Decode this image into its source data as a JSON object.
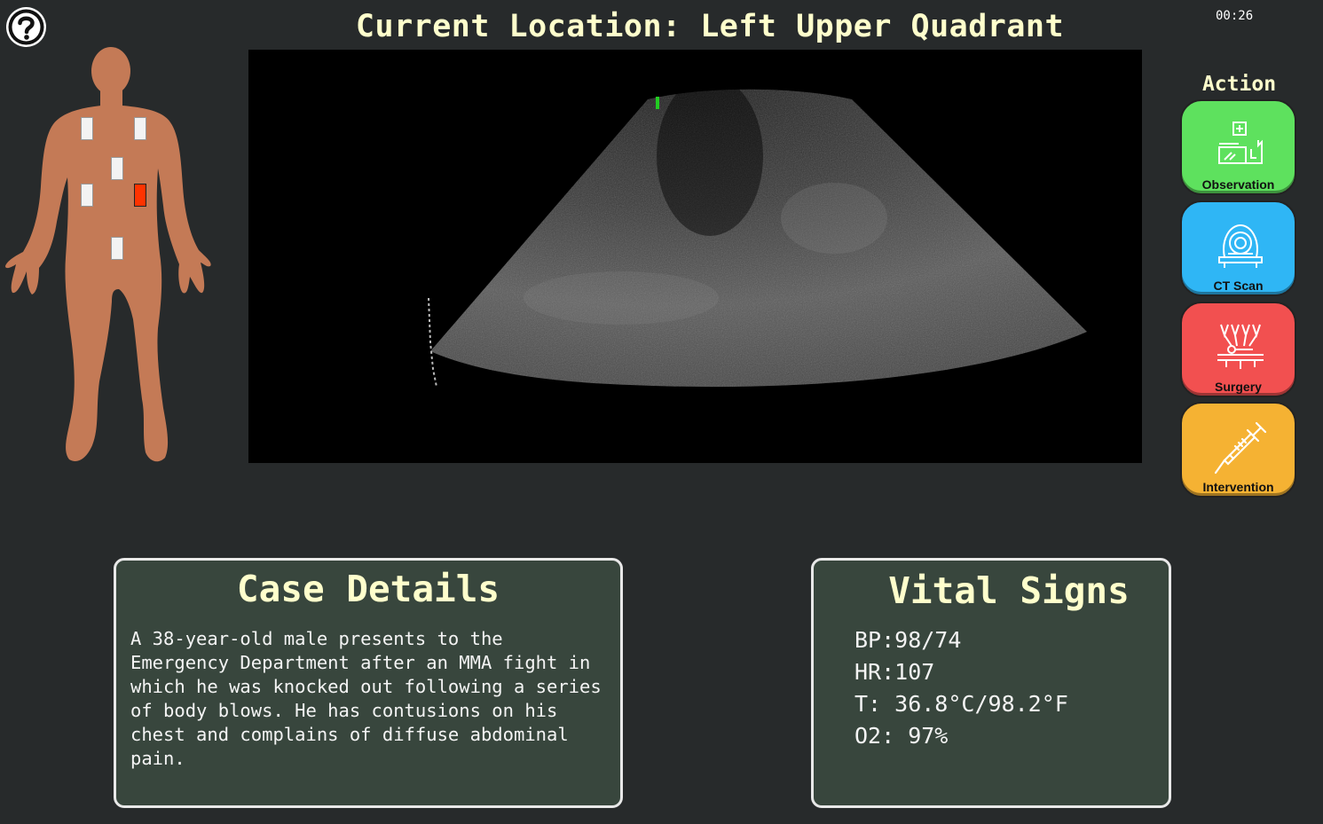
{
  "header": {
    "location_text": "Current Location: Left Upper Quadrant",
    "timer": "00:26"
  },
  "help": {
    "icon": "question-mark-icon"
  },
  "body_map": {
    "zones": [
      {
        "name": "right-chest",
        "active": false
      },
      {
        "name": "left-chest",
        "active": false
      },
      {
        "name": "subxiphoid",
        "active": false
      },
      {
        "name": "right-upper-quadrant",
        "active": false
      },
      {
        "name": "left-upper-quadrant",
        "active": true
      },
      {
        "name": "pelvis",
        "active": false
      }
    ],
    "colors": {
      "skin": "#c47a56",
      "zone": "#f3f3f3",
      "active_zone": "#ff3300"
    }
  },
  "ultrasound": {
    "probe_marker_color": "#22cc22"
  },
  "actions": {
    "title": "Action",
    "buttons": [
      {
        "label": "Observation",
        "color": "#5ee15e",
        "icon": "observation-bed-icon"
      },
      {
        "label": "CT Scan",
        "color": "#2fb6f5",
        "icon": "ct-scanner-icon"
      },
      {
        "label": "Surgery",
        "color": "#f25050",
        "icon": "surgery-icon"
      },
      {
        "label": "Intervention",
        "color": "#f5b233",
        "icon": "syringe-icon"
      }
    ]
  },
  "case": {
    "title": "Case Details",
    "text": "A 38-year-old male presents to the\nEmergency Department after an MMA fight in\nwhich he was knocked out following a series\nof body blows. He has contusions on his\nchest and complains of diffuse abdominal\npain."
  },
  "vitals": {
    "title": "Vital Signs",
    "bp": "BP:98/74",
    "hr": "HR:107",
    "temp": "T: 36.8°C/98.2°F",
    "o2": "O2: 97%"
  },
  "colors": {
    "background": "#272a2b",
    "heading": "#ffffcc",
    "panel_bg": "#38463d",
    "panel_border": "#e8e8e8"
  }
}
